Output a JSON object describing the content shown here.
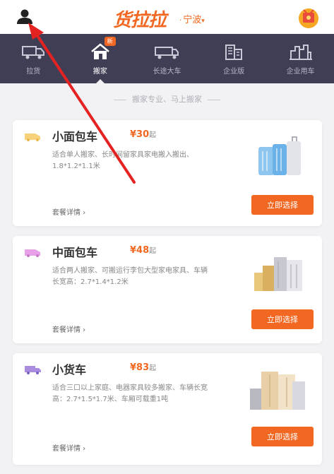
{
  "header": {
    "logo": "货拉拉",
    "city": "宁波",
    "city_separator": "·",
    "city_chevron": "▾"
  },
  "nav": {
    "badge": "新",
    "items": [
      {
        "label": "拉货"
      },
      {
        "label": "搬家"
      },
      {
        "label": "长途大车"
      },
      {
        "label": "企业版"
      },
      {
        "label": "企业用车"
      }
    ]
  },
  "hint": "搬家专业、马上搬家",
  "colors": {
    "accent": "#f26722",
    "nav_bg": "#3f3e55",
    "small_icon": "#f7d27a",
    "medium_icon": "#e8a0e8",
    "large_icon": "#a98be0"
  },
  "cards": [
    {
      "title": "小面包车",
      "price": "¥30",
      "price_unit": "起",
      "spec": "适合单人搬家、长时间留家具家电搬入搬出、1.8*1.2*1.1米",
      "detail": "套餐详情 ›",
      "button": "立即选择",
      "icon": "van-icon"
    },
    {
      "title": "中面包车",
      "price": "¥48",
      "price_unit": "起",
      "spec": "适合两人搬家、可搬运行李包大型家电家具、车辆长宽高：2.7*1.4*1.2米",
      "detail": "套餐详情 ›",
      "button": "立即选择",
      "icon": "van-icon"
    },
    {
      "title": "小货车",
      "price": "¥83",
      "price_unit": "起",
      "spec": "适合三口以上家庭、电器家具较多搬家、车辆长宽高：2.7*1.5*1.7米、车厢可载重1吨",
      "detail": "套餐详情 ›",
      "button": "立即选择",
      "icon": "truck-icon"
    }
  ]
}
